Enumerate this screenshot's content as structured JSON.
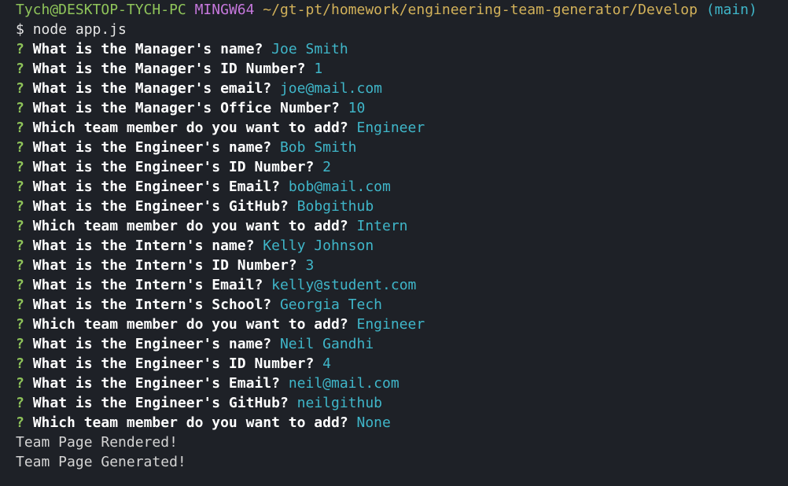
{
  "header": {
    "user_host": "Tych@DESKTOP-TYCH-PC",
    "env": "MINGW64",
    "path": "~/gt-pt/homework/engineering-team-generator/Develop",
    "branch": "(main)"
  },
  "command": {
    "prompt": "$",
    "text": "node app.js"
  },
  "qa": [
    {
      "mark": "?",
      "q": "What is the Manager's name?",
      "a": "Joe Smith"
    },
    {
      "mark": "?",
      "q": "What is the Manager's ID Number?",
      "a": "1"
    },
    {
      "mark": "?",
      "q": "What is the Manager's email?",
      "a": "joe@mail.com"
    },
    {
      "mark": "?",
      "q": "What is the Manager's Office Number?",
      "a": "10"
    },
    {
      "mark": "?",
      "q": "Which team member do you want to add?",
      "a": "Engineer"
    },
    {
      "mark": "?",
      "q": "What is the Engineer's name?",
      "a": "Bob Smith"
    },
    {
      "mark": "?",
      "q": "What is the Engineer's ID Number?",
      "a": "2"
    },
    {
      "mark": "?",
      "q": "What is the Engineer's Email?",
      "a": "bob@mail.com"
    },
    {
      "mark": "?",
      "q": "What is the Engineer's GitHub?",
      "a": "Bobgithub"
    },
    {
      "mark": "?",
      "q": "Which team member do you want to add?",
      "a": "Intern"
    },
    {
      "mark": "?",
      "q": "What is the Intern's name?",
      "a": "Kelly Johnson"
    },
    {
      "mark": "?",
      "q": "What is the Intern's ID Number?",
      "a": "3"
    },
    {
      "mark": "?",
      "q": "What is the Intern's Email?",
      "a": "kelly@student.com"
    },
    {
      "mark": "?",
      "q": "What is the Intern's School?",
      "a": "Georgia Tech"
    },
    {
      "mark": "?",
      "q": "Which team member do you want to add?",
      "a": "Engineer"
    },
    {
      "mark": "?",
      "q": "What is the Engineer's name?",
      "a": "Neil Gandhi"
    },
    {
      "mark": "?",
      "q": "What is the Engineer's ID Number?",
      "a": "4"
    },
    {
      "mark": "?",
      "q": "What is the Engineer's Email?",
      "a": "neil@mail.com"
    },
    {
      "mark": "?",
      "q": "What is the Engineer's GitHub?",
      "a": "neilgithub"
    },
    {
      "mark": "?",
      "q": "Which team member do you want to add?",
      "a": "None"
    }
  ],
  "output": [
    "Team Page Rendered!",
    "Team Page Generated!"
  ],
  "colors": {
    "background": "#1e2127",
    "user_host": "#8fc45a",
    "env": "#c678dd",
    "path": "#d3b25a",
    "answer": "#3fb6c9"
  }
}
